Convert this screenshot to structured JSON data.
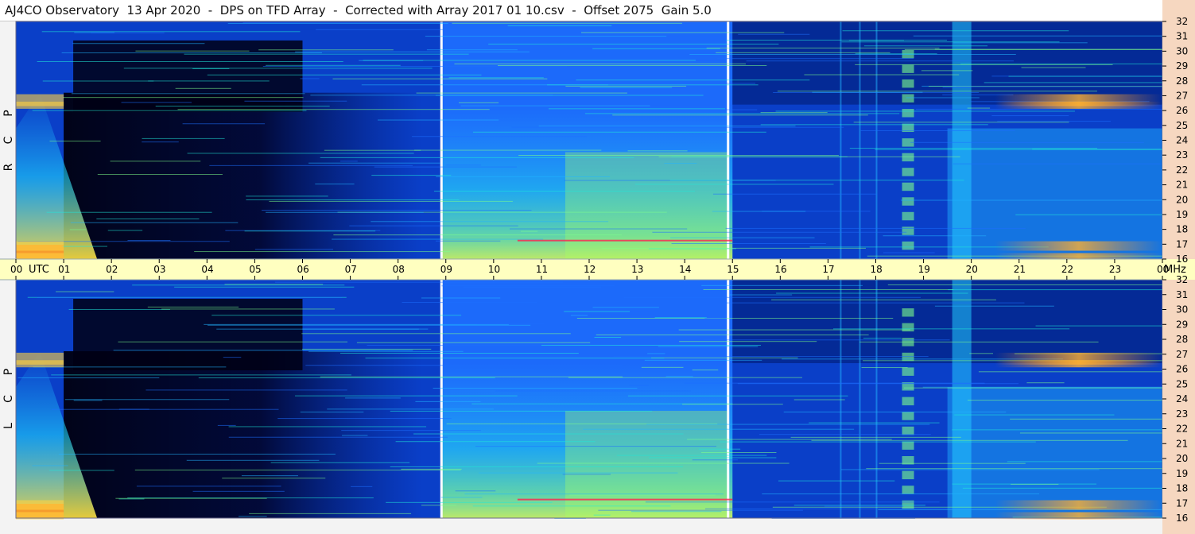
{
  "title": "AJ4CO Observatory  13 Apr 2020  -  DPS on TFD Array  -  Corrected with Array 2017 01 10.csv  -  Offset 2075  Gain 5.0",
  "colors": {
    "time_axis_bg": "#ffffc0",
    "freq_axis_bg": "#f6d7c0",
    "colormap": [
      "#000018",
      "#001a6e",
      "#0a3fc8",
      "#1e6fff",
      "#22b5ff",
      "#20e8d8",
      "#7dff8a",
      "#ffff40",
      "#ff9020",
      "#ff2050"
    ]
  },
  "chart_data": [
    {
      "type": "heatmap",
      "panel": "RCP",
      "channel_label": [
        "R",
        "C",
        "P"
      ],
      "x_unit": "UTC",
      "y_unit": "MHz",
      "x_ticks": [
        "00",
        "01",
        "02",
        "03",
        "04",
        "05",
        "06",
        "07",
        "08",
        "09",
        "10",
        "11",
        "12",
        "13",
        "14",
        "15",
        "16",
        "17",
        "18",
        "19",
        "20",
        "21",
        "22",
        "23",
        "00"
      ],
      "y_ticks": [
        "16",
        "17",
        "18",
        "19",
        "20",
        "21",
        "22",
        "23",
        "24",
        "25",
        "26",
        "27",
        "28",
        "29",
        "30",
        "31",
        "32"
      ],
      "xlim": [
        0,
        24
      ],
      "ylim": [
        16,
        32
      ],
      "grid": false
    },
    {
      "type": "heatmap",
      "panel": "LCP",
      "channel_label": [
        "L",
        "C",
        "P"
      ],
      "x_unit": "UTC",
      "y_unit": "MHz",
      "x_ticks": [
        "00",
        "01",
        "02",
        "03",
        "04",
        "05",
        "06",
        "07",
        "08",
        "09",
        "10",
        "11",
        "12",
        "13",
        "14",
        "15",
        "16",
        "17",
        "18",
        "19",
        "20",
        "21",
        "22",
        "23",
        "00"
      ],
      "y_ticks": [
        "16",
        "17",
        "18",
        "19",
        "20",
        "21",
        "22",
        "23",
        "24",
        "25",
        "26",
        "27",
        "28",
        "29",
        "30",
        "31",
        "32"
      ],
      "xlim": [
        0,
        24
      ],
      "ylim": [
        16,
        32
      ],
      "grid": false
    }
  ]
}
